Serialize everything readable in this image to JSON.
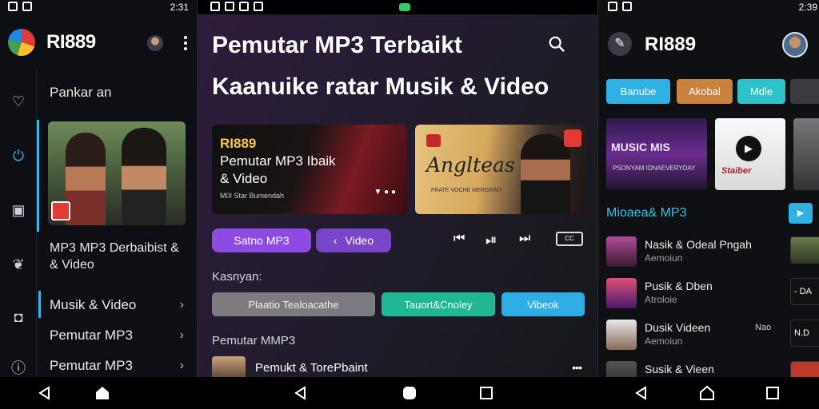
{
  "left": {
    "status_time": "2:31",
    "brand": "RI889",
    "title": "Pankar an",
    "video_caption": "MP3 MP3 Derbaibist & & Video",
    "menu": [
      "Musik & Video",
      "Pemutar MP3",
      "Pemutar MP3"
    ],
    "rail_icons": [
      "heart-icon",
      "upload-icon",
      "tv-icon",
      "lotus-icon",
      "briefcase-icon",
      "info-icon"
    ]
  },
  "center": {
    "title_line1": "Pemutar MP3 Terbaikt",
    "title_line2": "Kaanuike ratar Musik & Video",
    "card1": {
      "brand": "RI889",
      "line1": "Pemutar MP3 Ibaik",
      "line2": "& Video",
      "small": "M0I Star Bumendah"
    },
    "card2": {
      "title": "Anglteas",
      "small": "FRATE VOCHE MERGRINT"
    },
    "pill_a": "Satno MP3",
    "pill_b": "Video",
    "captions_label": "CC",
    "label_kasnyan": "Kasnyan:",
    "tags": [
      "Plaatio Tealoacathe",
      "Tauort&Cnoley",
      "Vibeok"
    ],
    "section_title": "Pemutar MMP3",
    "row_title": "Pemukt & TorePbaint"
  },
  "right": {
    "status_time": "2:39",
    "brand": "RI889",
    "chips": [
      "Banube",
      "Akobal",
      "Mdle"
    ],
    "tile1_caption": "MUSIC MIS",
    "tile1_small": "PSONYAM IDNAEVERYDAY",
    "tile2_caption": "Staiber",
    "section_title": "Mioaea& MP3",
    "items": [
      {
        "title": "Nasik & Odeal Pngah",
        "subtitle": "Aemoiun",
        "extra": "",
        "side": ""
      },
      {
        "title": "Pusik & Dben",
        "subtitle": "Atroloie",
        "extra": "",
        "side": "- DA"
      },
      {
        "title": "Dusik Videen",
        "subtitle": "Aemoiun",
        "extra": "Nao",
        "side": "N.D"
      },
      {
        "title": "Susik & Vieen",
        "subtitle": "",
        "extra": "",
        "side": ""
      }
    ]
  }
}
